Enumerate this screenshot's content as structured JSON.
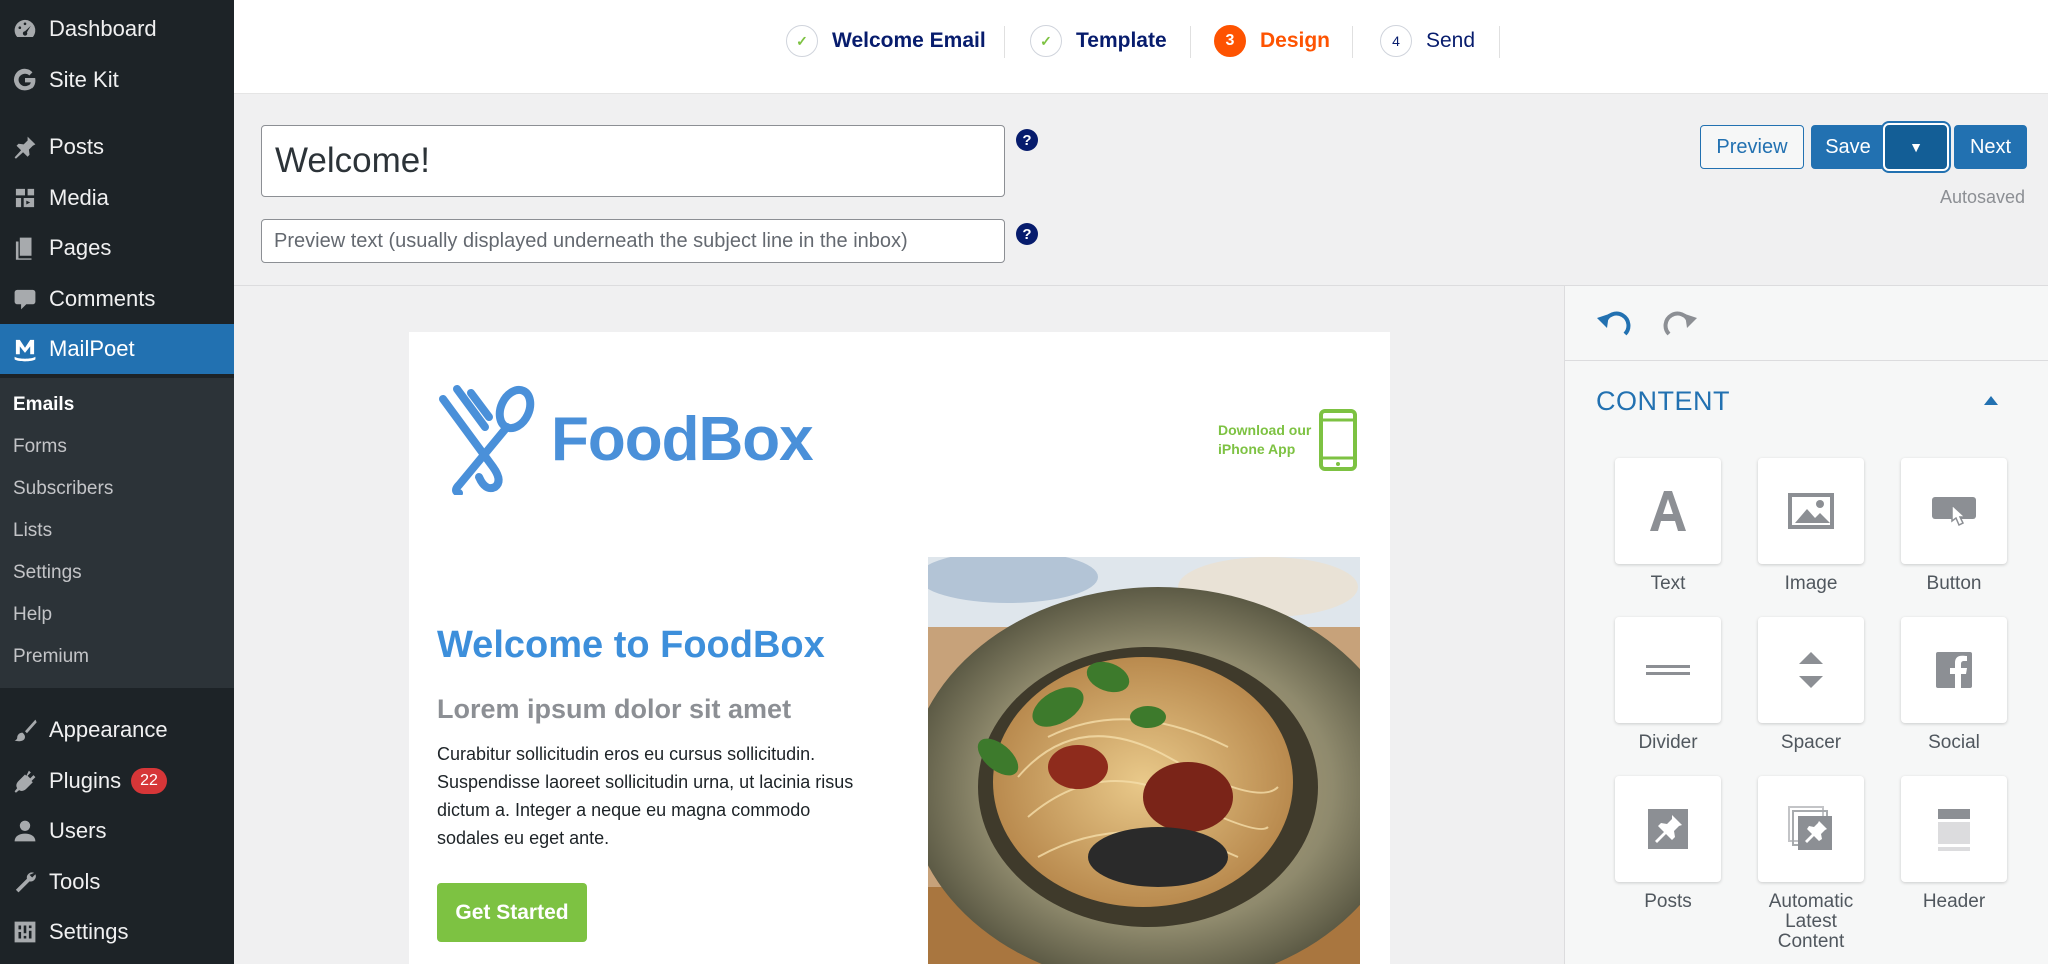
{
  "sidebar": {
    "items": [
      {
        "label": "Dashboard",
        "icon": "dashboard-icon"
      },
      {
        "label": "Site Kit",
        "icon": "google-g-icon"
      },
      {
        "label": "Posts",
        "icon": "pushpin-icon"
      },
      {
        "label": "Media",
        "icon": "media-icon"
      },
      {
        "label": "Pages",
        "icon": "pages-icon"
      },
      {
        "label": "Comments",
        "icon": "comment-icon"
      },
      {
        "label": "MailPoet",
        "icon": "mailpoet-icon"
      },
      {
        "label": "Appearance",
        "icon": "paintbrush-icon"
      },
      {
        "label": "Plugins",
        "icon": "plugin-icon",
        "badge": "22"
      },
      {
        "label": "Users",
        "icon": "user-icon"
      },
      {
        "label": "Tools",
        "icon": "wrench-icon"
      },
      {
        "label": "Settings",
        "icon": "settings-icon"
      }
    ],
    "submenu": [
      "Emails",
      "Forms",
      "Subscribers",
      "Lists",
      "Settings",
      "Help",
      "Premium"
    ],
    "active_colors": {
      "current_bg": "#2271b1",
      "sidebar_bg": "#1d2327",
      "submenu_bg": "#2c3338",
      "badge": "#d63638"
    }
  },
  "stepper": {
    "steps": [
      {
        "num": "✓",
        "label": "Welcome Email",
        "state": "done"
      },
      {
        "num": "✓",
        "label": "Template",
        "state": "done"
      },
      {
        "num": "3",
        "label": "Design",
        "state": "active"
      },
      {
        "num": "4",
        "label": "Send",
        "state": "todo"
      }
    ],
    "active_color": "#fe5301"
  },
  "header": {
    "subject_value": "Welcome!",
    "preheader_placeholder": "Preview text (usually displayed underneath the subject line in the inbox)",
    "help_glyph": "?",
    "buttons": {
      "preview": "Preview",
      "save": "Save",
      "save_dropdown": "▼",
      "next": "Next"
    },
    "autosave_status": "Autosaved"
  },
  "email": {
    "logo_text": "FoodBox",
    "app_promo": {
      "line1": "Download our",
      "line2": "iPhone App"
    },
    "hero_title": "Welcome to FoodBox",
    "hero_subtitle": "Lorem ipsum dolor sit amet",
    "hero_body": "Curabitur sollicitudin eros eu cursus sollicitudin. Suspendisse laoreet sollicitudin urna, ut lacinia risus dictum a. Integer a neque eu magna commodo sodales eu eget ante.",
    "cta_label": "Get Started",
    "colors": {
      "brand_blue": "#4a90d9",
      "cta_green": "#7dc242"
    }
  },
  "panel": {
    "section_title": "CONTENT",
    "widgets": [
      {
        "label": "Text",
        "icon": "text-icon"
      },
      {
        "label": "Image",
        "icon": "image-icon"
      },
      {
        "label": "Button",
        "icon": "button-icon"
      },
      {
        "label": "Divider",
        "icon": "divider-icon"
      },
      {
        "label": "Spacer",
        "icon": "spacer-icon"
      },
      {
        "label": "Social",
        "icon": "social-icon"
      },
      {
        "label": "Posts",
        "icon": "posts-icon"
      },
      {
        "label": "Automatic Latest Content",
        "icon": "alc-icon"
      },
      {
        "label": "Header",
        "icon": "header-icon"
      }
    ]
  }
}
